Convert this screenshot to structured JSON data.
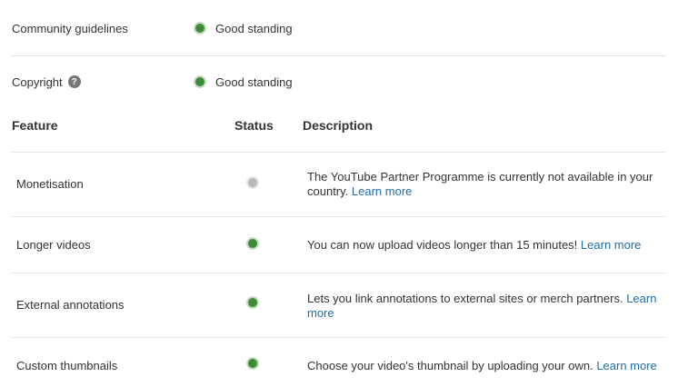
{
  "standing": {
    "community": {
      "label": "Community guidelines",
      "status": "Good standing"
    },
    "copyright": {
      "label": "Copyright",
      "help": "?",
      "status": "Good standing"
    }
  },
  "table": {
    "headers": {
      "feature": "Feature",
      "status": "Status",
      "description": "Description"
    },
    "rows": [
      {
        "feature": "Monetisation",
        "status_color": "grey",
        "description": "The YouTube Partner Programme is currently not available in your country.",
        "link": "Learn more"
      },
      {
        "feature": "Longer videos",
        "status_color": "green",
        "description": "You can now upload videos longer than 15 minutes!",
        "link": "Learn more"
      },
      {
        "feature": "External annotations",
        "status_color": "green",
        "description": "Lets you link annotations to external sites or merch partners.",
        "link": "Learn more"
      },
      {
        "feature": "Custom thumbnails",
        "status_color": "green",
        "description": "Choose your video's thumbnail by uploading your own.",
        "link": "Learn more"
      }
    ]
  },
  "colors": {
    "good": "#3f8a36",
    "unavailable": "#b8b8b8",
    "link": "#1f6ea8"
  }
}
